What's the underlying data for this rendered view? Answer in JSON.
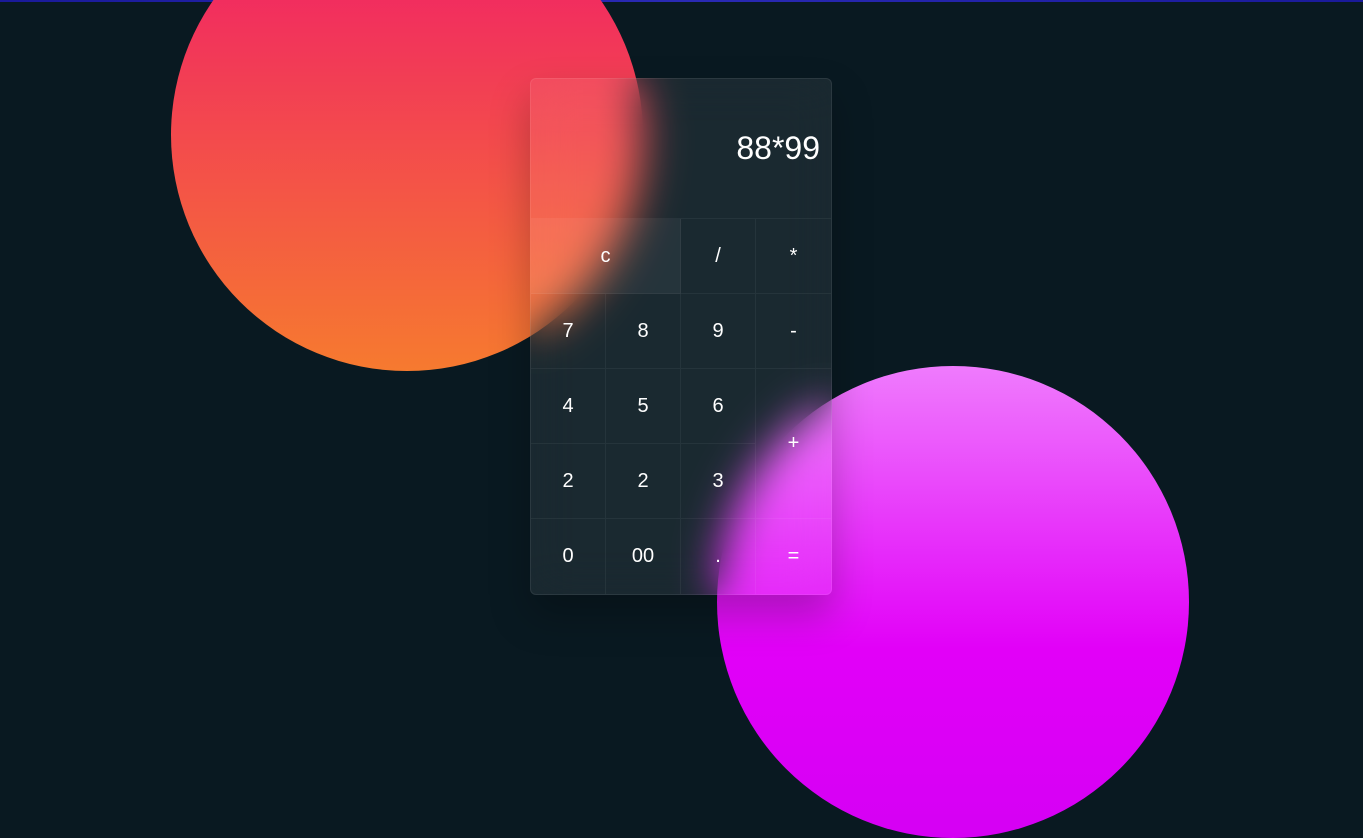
{
  "display": {
    "value": "88*99"
  },
  "keys": {
    "clear": "c",
    "divide": "/",
    "multiply": "*",
    "seven": "7",
    "eight": "8",
    "nine": "9",
    "minus": "-",
    "four": "4",
    "five": "5",
    "six": "6",
    "plus": "+",
    "two_a": "2",
    "two_b": "2",
    "three": "3",
    "zero": "0",
    "double_zero": "00",
    "decimal": ".",
    "equals": "="
  },
  "colors": {
    "background": "#091921",
    "circle_orange_top": "#f0196b",
    "circle_orange_bottom": "#f67a2f",
    "circle_pink_top": "#ef7bfd",
    "circle_pink_bottom": "#d500f4"
  }
}
